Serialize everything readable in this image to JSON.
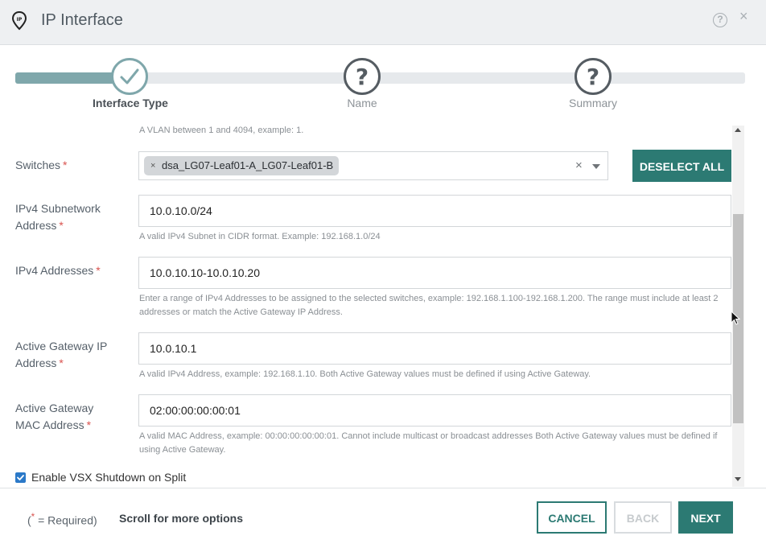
{
  "header": {
    "title": "IP Interface",
    "help_icon": "question-circle-icon",
    "close_label": "×"
  },
  "stepper": {
    "progress": 0.15,
    "steps": [
      {
        "label": "Interface Type",
        "state": "done"
      },
      {
        "label": "Name",
        "state": "todo"
      },
      {
        "label": "Summary",
        "state": "todo"
      }
    ]
  },
  "form": {
    "vlan_hint": "A VLAN between 1 and 4094, example: 1.",
    "switches": {
      "label": "Switches",
      "required": "*",
      "chip": "dsa_LG07-Leaf01-A_LG07-Leaf01-B",
      "chip_remove": "×",
      "clear": "×",
      "deselect_label": "DESELECT ALL"
    },
    "ipv4_subnet": {
      "label_line1": "IPv4 Subnetwork",
      "label_line2": "Address",
      "required": "*",
      "value": "10.0.10.0/24",
      "hint": "A valid IPv4 Subnet in CIDR format. Example: 192.168.1.0/24"
    },
    "ipv4_addresses": {
      "label": "IPv4 Addresses",
      "required": "*",
      "value": "10.0.10.10-10.0.10.20",
      "hint_line1": "Enter a range of IPv4 Addresses to be assigned to the selected switches, example: 192.168.1.100-192.168.1.200. The range must include at least 2",
      "hint_line2": "addresses or match the Active Gateway IP Address."
    },
    "gateway_ip": {
      "label_line1": "Active Gateway IP",
      "label_line2": "Address",
      "required": "*",
      "value": "10.0.10.1",
      "hint": "A valid IPv4 Address, example: 192.168.1.10. Both Active Gateway values must be defined if using Active Gateway."
    },
    "gateway_mac": {
      "label_line1": "Active Gateway",
      "label_line2": "MAC Address",
      "required": "*",
      "value": "02:00:00:00:00:01",
      "hint_line1": "A valid MAC Address, example: 00:00:00:00:00:01. Cannot include multicast or broadcast addresses Both Active Gateway values must be defined if",
      "hint_line2": "using Active Gateway."
    },
    "vsx_shutdown": {
      "label": "Enable VSX Shutdown on Split",
      "checked": true
    }
  },
  "footer": {
    "legend_open": "(",
    "legend_star": "*",
    "legend_rest": " = Required)",
    "scroll_hint": "Scroll for more options",
    "cancel": "CANCEL",
    "back": "BACK",
    "next": "NEXT"
  },
  "colors": {
    "primary": "#2c7a73",
    "step_done": "#7fa7ab",
    "required": "#d9534f",
    "checkbox": "#2b79c8"
  }
}
